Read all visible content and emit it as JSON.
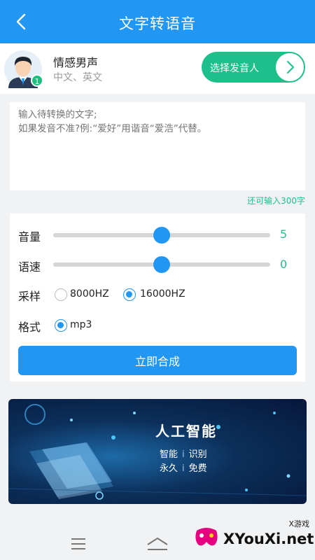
{
  "header": {
    "title": "文字转语音"
  },
  "speaker": {
    "name": "情感男声",
    "languages": "中文、英文",
    "badge": "1",
    "select_label": "选择发音人"
  },
  "input": {
    "placeholder": "输入待转换的文字;\n如果发音不准?例:“爱好”用谐音“爱浩”代替。",
    "remaining": "还可输入300字"
  },
  "settings": {
    "volume": {
      "label": "音量",
      "value": "5",
      "level": 0.5
    },
    "speed": {
      "label": "语速",
      "value": "0",
      "level": 0.5
    },
    "sample": {
      "label": "采样",
      "options": [
        "8000HZ",
        "16000HZ"
      ],
      "selected": "16000HZ"
    },
    "format": {
      "label": "格式",
      "options": [
        "mp3"
      ],
      "selected": "mp3"
    },
    "synth_label": "立即合成"
  },
  "banner": {
    "title": "人工智能",
    "line1": {
      "a": "智能",
      "sep": "i",
      "b": "识别"
    },
    "line2": {
      "a": "永久",
      "sep": "i",
      "b": "免费"
    }
  },
  "watermark": {
    "small": "X游戏",
    "big": "XYouXi.net"
  },
  "colors": {
    "primary": "#2196f3",
    "accent": "#1fbf8c"
  },
  "icons": [
    "back-icon",
    "chevron-right-icon",
    "menu-icon",
    "home-icon"
  ]
}
